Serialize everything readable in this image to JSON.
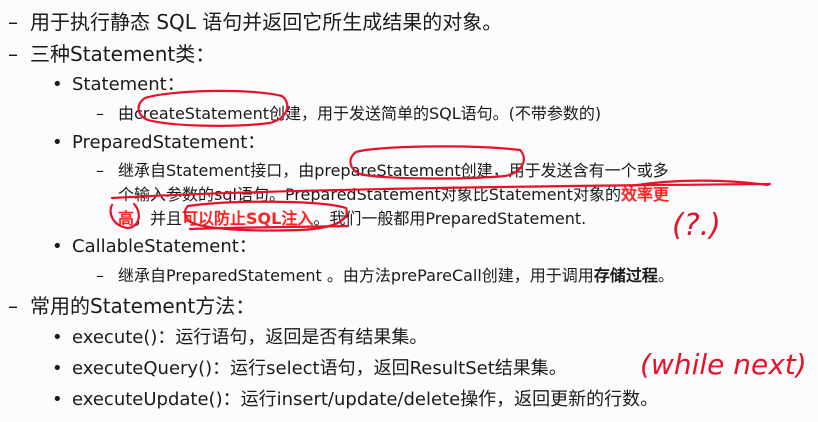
{
  "lines": {
    "intro": "用于执行静态 SQL 语句并返回它所生成结果的对象。",
    "types_heading": "三种Statement类：",
    "statement_title": "Statement：",
    "statement_desc": "由createStatement创建，用于发送简单的SQL语句。(不带参数的)",
    "prepared_title": "PreparedStatement：",
    "prepared_desc_1": "继承自Statement接口，由prepareStatement创建，用于发送含有一个或多",
    "prepared_desc_2a": "个输入参数的sql语句。PreparedStatement对象比Statement对象的",
    "prepared_desc_2b": "效率更",
    "prepared_desc_3a": "高",
    "prepared_desc_3b": "，并且",
    "prepared_desc_3c": "可以防止SQL注入",
    "prepared_desc_3d": "。我们一般都用PreparedStatement.",
    "callable_title": "CallableStatement：",
    "callable_desc_a": "继承自PreparedStatement 。由方法prePareCall创建，用于调用",
    "callable_desc_b": "存储过程",
    "callable_desc_c": "。",
    "methods_heading": "常用的Statement方法：",
    "method_execute": "execute()：运行语句，返回是否有结果集。",
    "method_query": "executeQuery()：运行select语句，返回ResultSet结果集。",
    "method_update": "executeUpdate()：运行insert/update/delete操作，返回更新的行数。"
  },
  "markers": {
    "dash": "–",
    "bullet": "•"
  },
  "handwriting": {
    "question": "(?.)",
    "note": "(while next)"
  },
  "colors": {
    "emphasis": "#ff2222",
    "ink": "#e8102a"
  }
}
